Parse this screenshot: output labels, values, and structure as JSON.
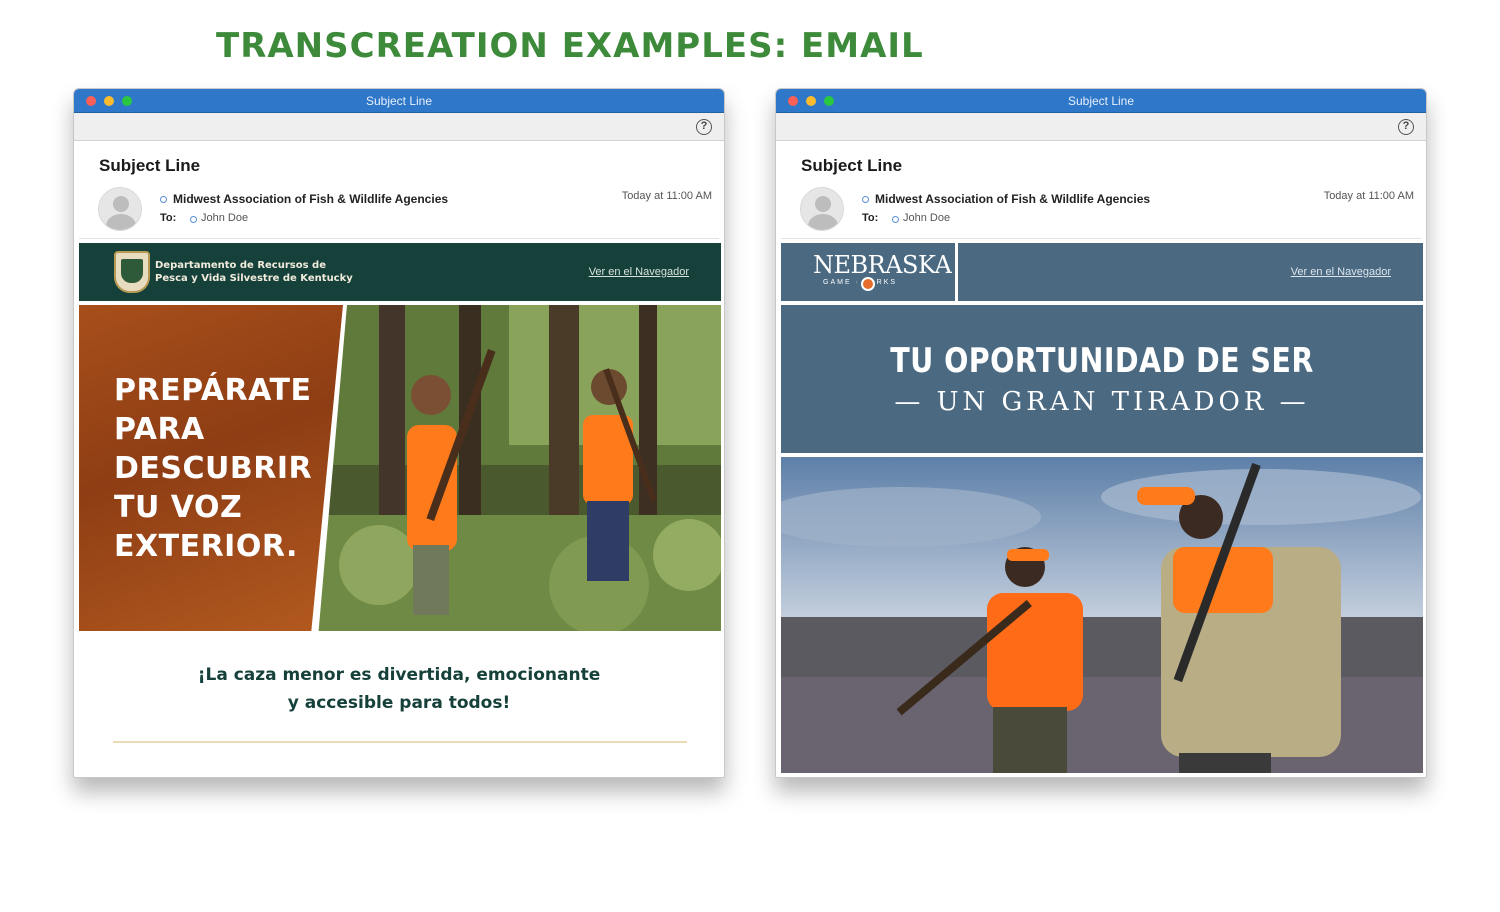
{
  "page": {
    "heading": "TRANSCREATION EXAMPLES: EMAIL"
  },
  "left_email": {
    "window_title": "Subject Line",
    "subject": "Subject Line",
    "sender": "Midwest Association of Fish & Wildlife Agencies",
    "to_label": "To:",
    "to_name": "John Doe",
    "timestamp": "Today at 11:00 AM",
    "brand_line_1": "Departamento de Recursos de",
    "brand_line_2": "Pesca y Vida Silvestre de Kentucky",
    "browser_link": "Ver en el Navegador",
    "headline": [
      "PREPÁRATE",
      "PARA",
      "DESCUBRIR",
      "TU VOZ",
      "EXTERIOR."
    ],
    "tagline_1": "¡La caza menor es divertida, emocionante",
    "tagline_2": "y accesible para todos!",
    "colors": {
      "banner": "#16403a",
      "accent": "#a84f1b"
    }
  },
  "right_email": {
    "window_title": "Subject Line",
    "subject": "Subject Line",
    "sender": "Midwest Association of Fish & Wildlife Agencies",
    "to_label": "To:",
    "to_name": "John Doe",
    "timestamp": "Today at 11:00 AM",
    "logo_text": "NEBRASKA",
    "logo_sub": "GAME · PARKS",
    "browser_link": "Ver en el Navegador",
    "title_1": "TU OPORTUNIDAD DE SER",
    "title_2": "— UN GRAN TIRADOR —",
    "colors": {
      "banner": "#4b6a82"
    }
  },
  "colors": {
    "heading": "#3d8a3a",
    "titlebar": "#2f77c9"
  },
  "icons": [
    "help-icon",
    "avatar-icon"
  ]
}
